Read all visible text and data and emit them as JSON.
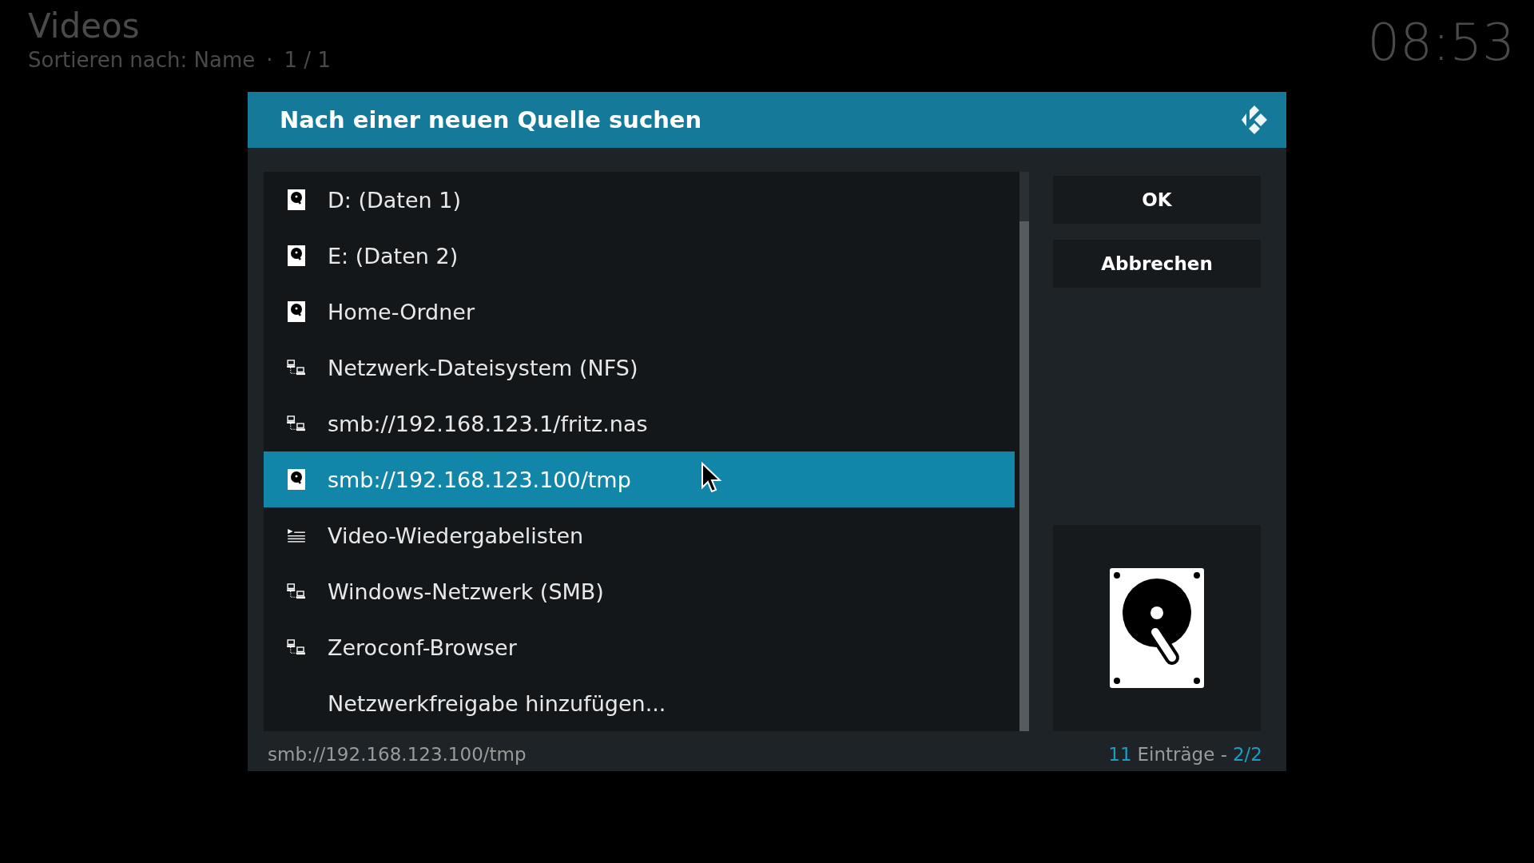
{
  "background": {
    "title": "Videos",
    "sort_label": "Sortieren nach: Name",
    "separator": "·",
    "page": "1 / 1",
    "clock": "08:53"
  },
  "dialog": {
    "title": "Nach einer neuen Quelle suchen",
    "items": [
      {
        "label": "D: (Daten 1)",
        "kind": "drive",
        "selected": false
      },
      {
        "label": "E: (Daten 2)",
        "kind": "drive",
        "selected": false
      },
      {
        "label": "Home-Ordner",
        "kind": "drive",
        "selected": false
      },
      {
        "label": "Netzwerk-Dateisystem (NFS)",
        "kind": "network",
        "selected": false
      },
      {
        "label": "smb://192.168.123.1/fritz.nas",
        "kind": "network",
        "selected": false
      },
      {
        "label": "smb://192.168.123.100/tmp",
        "kind": "drive",
        "selected": true
      },
      {
        "label": "Video-Wiedergabelisten",
        "kind": "playlist",
        "selected": false
      },
      {
        "label": "Windows-Netzwerk (SMB)",
        "kind": "network",
        "selected": false
      },
      {
        "label": "Zeroconf-Browser",
        "kind": "network",
        "selected": false
      },
      {
        "label": "Netzwerkfreigabe hinzufügen...",
        "kind": "action",
        "selected": false
      }
    ],
    "buttons": [
      "OK",
      "Abbrechen"
    ],
    "path": "smb://192.168.123.100/tmp",
    "count": "11",
    "count_label": "Einträge -",
    "page": "2/2"
  }
}
